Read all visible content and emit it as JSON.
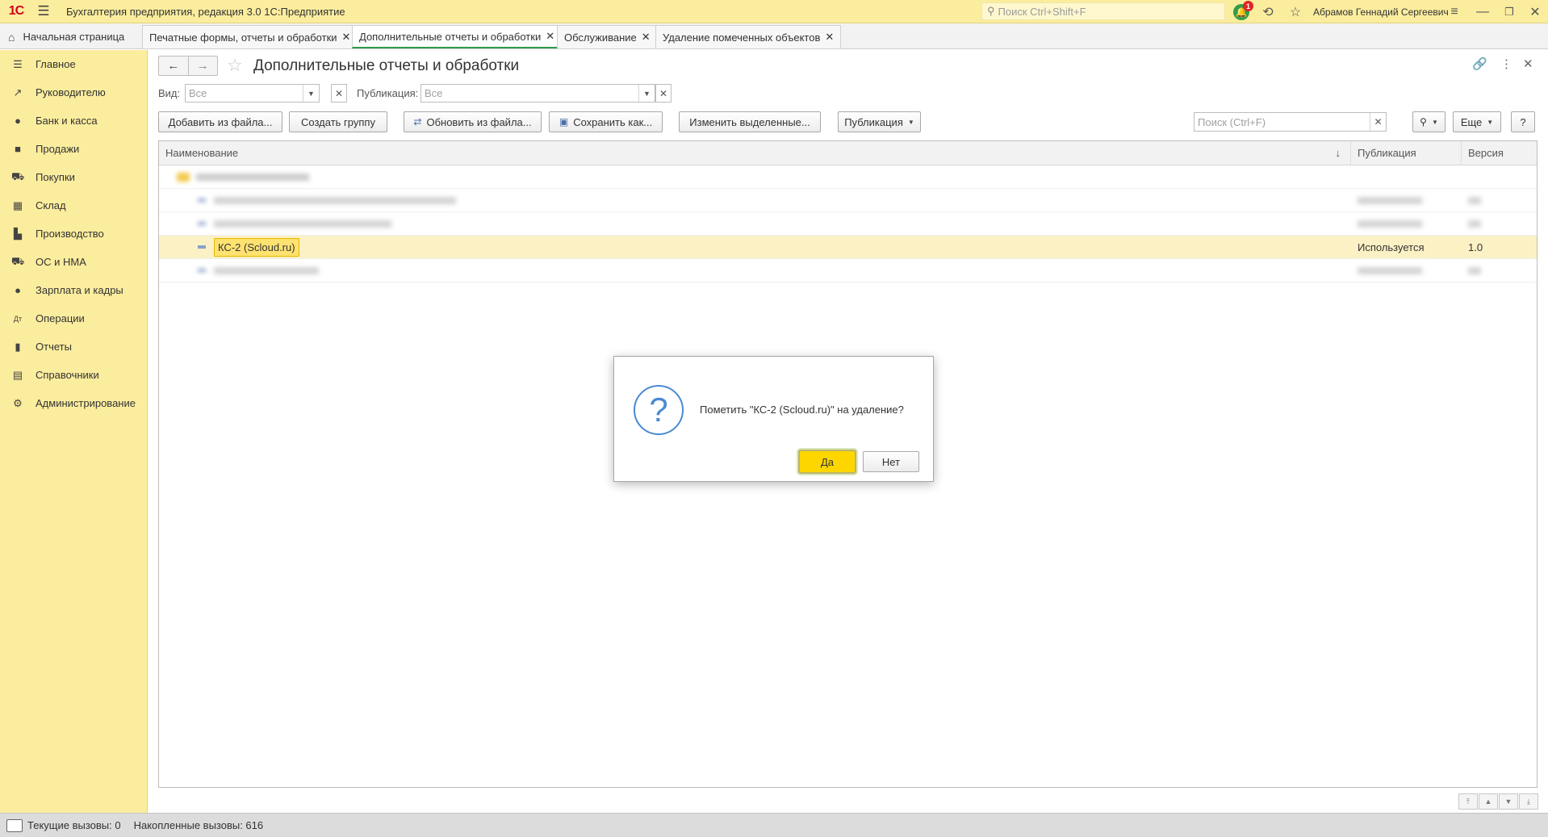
{
  "titlebar": {
    "app_title": "Бухгалтерия предприятия, редакция 3.0 1С:Предприятие",
    "search_placeholder": "Поиск Ctrl+Shift+F",
    "notification_count": "1",
    "user_name": "Абрамов Геннадий Сергеевич"
  },
  "tabs": [
    {
      "label": "Начальная страница"
    },
    {
      "label": "Печатные формы, отчеты и обработки"
    },
    {
      "label": "Дополнительные отчеты и обработки"
    },
    {
      "label": "Обслуживание"
    },
    {
      "label": "Удаление помеченных объектов"
    }
  ],
  "sidebar": {
    "items": [
      {
        "label": "Главное",
        "icon": "menu-icon"
      },
      {
        "label": "Руководителю",
        "icon": "trend-icon"
      },
      {
        "label": "Банк и касса",
        "icon": "coin-icon"
      },
      {
        "label": "Продажи",
        "icon": "bag-icon"
      },
      {
        "label": "Покупки",
        "icon": "cart-icon"
      },
      {
        "label": "Склад",
        "icon": "grid-icon"
      },
      {
        "label": "Производство",
        "icon": "factory-icon"
      },
      {
        "label": "ОС и НМА",
        "icon": "truck-icon"
      },
      {
        "label": "Зарплата и кадры",
        "icon": "person-icon"
      },
      {
        "label": "Операции",
        "icon": "dt-kt-icon"
      },
      {
        "label": "Отчеты",
        "icon": "bar-chart-icon"
      },
      {
        "label": "Справочники",
        "icon": "books-icon"
      },
      {
        "label": "Администрирование",
        "icon": "gear-icon"
      }
    ]
  },
  "main": {
    "title": "Дополнительные отчеты и обработки",
    "filters": {
      "vid_label": "Вид:",
      "vid_value": "Все",
      "publication_label": "Публикация:",
      "publication_value": "Все"
    },
    "toolbar": {
      "add_from_file": "Добавить из файла...",
      "create_group": "Создать группу",
      "update_from_file": "Обновить из файла...",
      "save_as": "Сохранить как...",
      "change_selected": "Изменить выделенные...",
      "publication": "Публикация",
      "search_placeholder": "Поиск (Ctrl+F)",
      "more": "Еще",
      "help": "?"
    },
    "table": {
      "headers": {
        "name": "Наименование",
        "publication": "Публикация",
        "version": "Версия"
      },
      "selected_row": {
        "name": "КС-2 (Scloud.ru)",
        "publication": "Используется",
        "version": "1.0"
      }
    }
  },
  "dialog": {
    "message": "Пометить \"КС-2 (Scloud.ru)\" на удаление?",
    "yes": "Да",
    "no": "Нет"
  },
  "statusbar": {
    "current_calls": "Текущие вызовы: 0",
    "accumulated_calls": "Накопленные вызовы: 616"
  },
  "colors": {
    "panel_yellow": "#fbed9e",
    "accent_green": "#2e9d4c",
    "selection_yellow": "#ffe270",
    "default_button": "#fdd600"
  }
}
